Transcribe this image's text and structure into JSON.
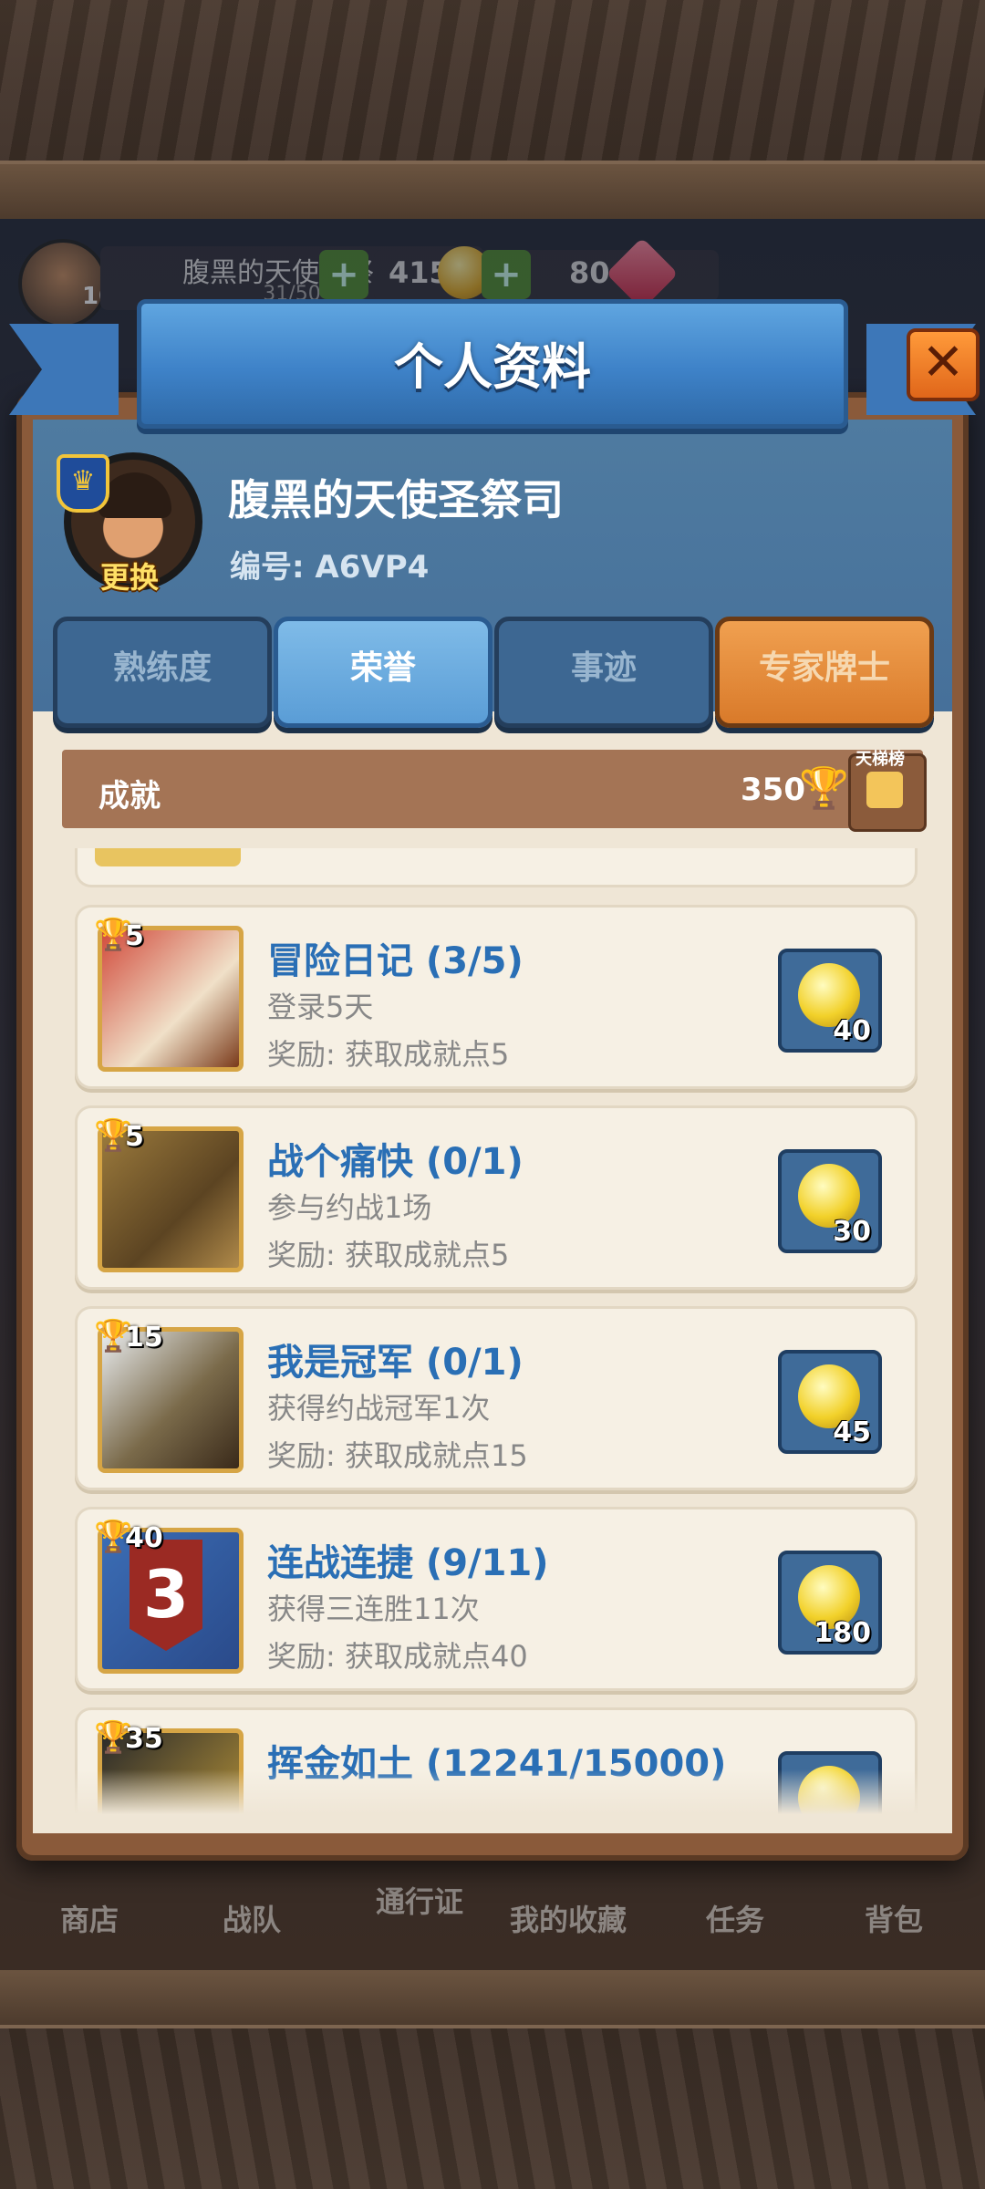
{
  "hud": {
    "level": "10",
    "player_name": "腹黑的天使圣祭司",
    "exp": "31/50",
    "gold": "4155",
    "gems": "80"
  },
  "bottom_nav": {
    "items": [
      "商店",
      "战队",
      "通行证",
      "我的收藏",
      "任务",
      "背包"
    ]
  },
  "modal": {
    "title": "个人资料",
    "close_icon": "close-icon"
  },
  "profile": {
    "name": "腹黑的天使圣祭司",
    "id": "编号: A6VP4",
    "change_label": "更换"
  },
  "tabs": [
    {
      "label": "熟练度"
    },
    {
      "label": "荣誉"
    },
    {
      "label": "事迹"
    },
    {
      "label": "专家牌士"
    }
  ],
  "achievements": {
    "header": "成就",
    "points": "350",
    "rank_label": "天梯榜",
    "items": [
      {
        "points": "5",
        "title": "冒险日记 (3/5)",
        "desc": "登录5天",
        "reward": "奖励: 获取成就点5",
        "coins": "40"
      },
      {
        "points": "5",
        "title": "战个痛快 (0/1)",
        "desc": "参与约战1场",
        "reward": "奖励: 获取成就点5",
        "coins": "30"
      },
      {
        "points": "15",
        "title": "我是冠军 (0/1)",
        "desc": "获得约战冠军1次",
        "reward": "奖励: 获取成就点15",
        "coins": "45"
      },
      {
        "points": "40",
        "title": "连战连捷 (9/11)",
        "desc": "获得三连胜11次",
        "reward": "奖励: 获取成就点40",
        "coins": "180"
      },
      {
        "points": "35",
        "title": "挥金如土 (12241/15000)",
        "desc": "",
        "reward": "",
        "coins": ""
      }
    ]
  },
  "colors": {
    "accent_blue": "#2a6fb5",
    "gold": "#f2c53a",
    "tab_active": "#5a9dd6"
  }
}
